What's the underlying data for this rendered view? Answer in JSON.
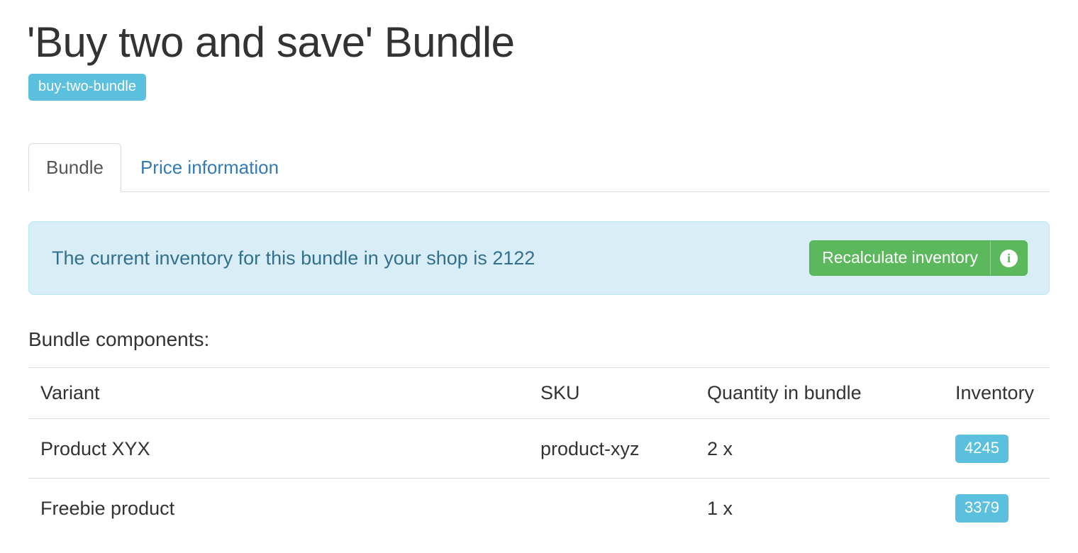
{
  "header": {
    "title": "'Buy two and save' Bundle",
    "slug": "buy-two-bundle",
    "slug_color": "#5bc0de"
  },
  "tabs": [
    {
      "label": "Bundle",
      "active": true
    },
    {
      "label": "Price information",
      "active": false
    }
  ],
  "alert": {
    "message": "The current inventory for this bundle in your shop is 2122",
    "inventory_value": "2122",
    "background_color": "#d9edf7",
    "border_color": "#bce8f1",
    "text_color": "#31708f",
    "button": {
      "label": "Recalculate inventory",
      "icon": "info-circle-icon",
      "color": "#5cb85c"
    }
  },
  "components": {
    "section_label": "Bundle components:",
    "columns": [
      "Variant",
      "SKU",
      "Quantity in bundle",
      "Inventory"
    ],
    "rows": [
      {
        "variant": "Product XYX",
        "sku": "product-xyz",
        "quantity": "2 x",
        "inventory": "4245"
      },
      {
        "variant": "Freebie product",
        "sku": "",
        "quantity": "1 x",
        "inventory": "3379"
      }
    ],
    "inventory_badge_color": "#5bc0de"
  }
}
